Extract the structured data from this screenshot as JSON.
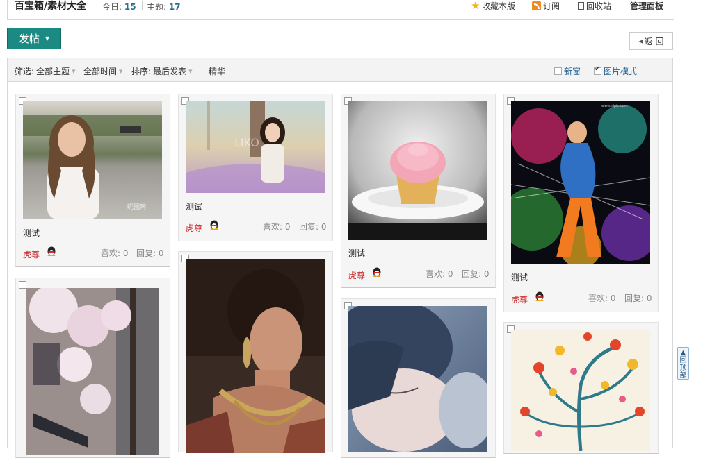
{
  "header": {
    "title": "百宝箱/素材大全",
    "today_label": "今日:",
    "today_value": "15",
    "topics_label": "主题:",
    "topics_value": "17",
    "actions": {
      "favorite": "收藏本版",
      "subscribe": "订阅",
      "recycle": "回收站",
      "admin": "管理面板"
    }
  },
  "toolbar": {
    "post_label": "发帖",
    "back_label": "返 回"
  },
  "filter": {
    "filter_label": "筛选:",
    "all_topics": "全部主题",
    "all_time": "全部时间",
    "sort_label": "排序:",
    "sort_value": "最后发表",
    "digest": "精华",
    "new_window": "新窗",
    "new_window_checked": false,
    "image_mode": "图片模式",
    "image_mode_checked": true
  },
  "cards": [
    {
      "title": "测试",
      "author": "虎尊",
      "likes": "喜欢: 0",
      "replies": "回复: 0",
      "image": "girl-street-photo"
    },
    {
      "title": "测试",
      "author": "虎尊",
      "likes": "喜欢: 0",
      "replies": "回复: 0",
      "image": "girl-flower-field-photo"
    },
    {
      "title": "测试",
      "author": "虎尊",
      "likes": "喜欢: 0",
      "replies": "回复: 0",
      "image": "pink-cupcake-photo"
    },
    {
      "title": "测试",
      "author": "虎尊",
      "likes": "喜欢: 0",
      "replies": "回复: 0",
      "image": "colorful-dancer-art"
    },
    {
      "image": "blossom-tree-photo"
    },
    {
      "image": "woman-profile-jewelry-photo"
    },
    {
      "image": "girl-closed-eyes-photo"
    },
    {
      "image": "flower-tree-illustration"
    }
  ],
  "totop": {
    "label": "回顶部"
  },
  "colors": {
    "accent": "#1b8a83",
    "author": "#c81e1e",
    "link": "#1f5f8f"
  },
  "image_watermarks": [
    "昵图网",
    "LIKO",
    "www.nipic.com"
  ]
}
